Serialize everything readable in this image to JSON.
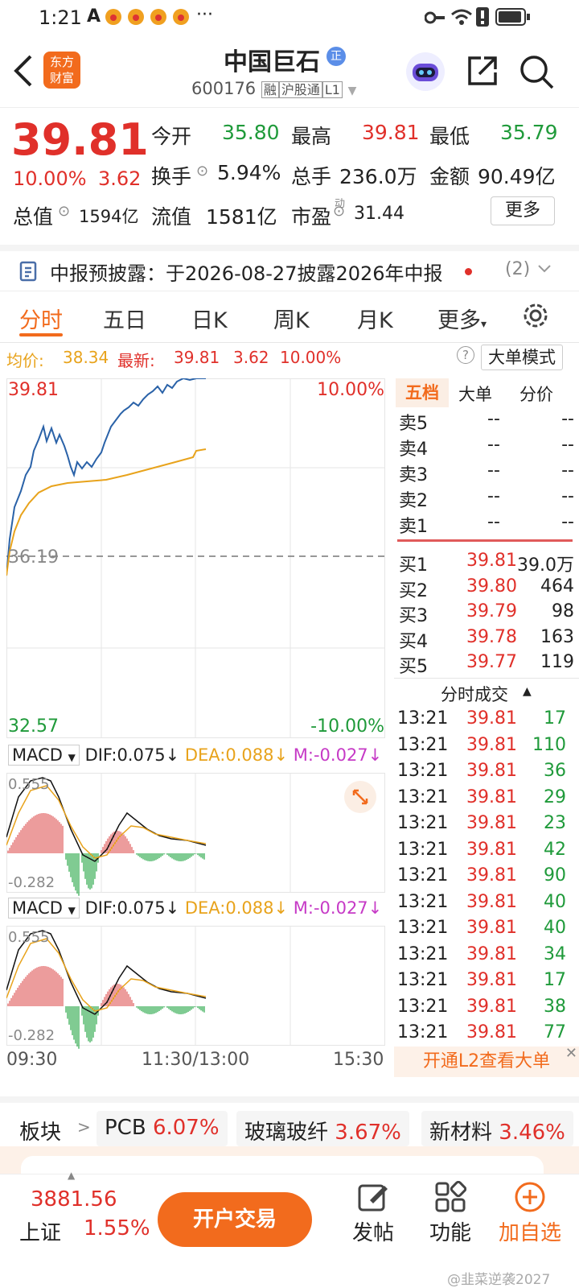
{
  "status_bar": {
    "time": "1:21",
    "alarm": "A",
    "dots": "···"
  },
  "header": {
    "logo_line1": "东方",
    "logo_line2": "财富",
    "title": "中国巨石",
    "title_badge": "正",
    "code": "600176",
    "tags": [
      "融",
      "沪股通",
      "L1"
    ]
  },
  "quote": {
    "price": "39.81",
    "change_pct": "10.00%",
    "change": "3.62",
    "open_label": "今开",
    "open": "35.80",
    "high_label": "最高",
    "high": "39.81",
    "low_label": "最低",
    "low": "35.79",
    "turnover_label": "换手",
    "turnover": "5.94%",
    "volume_label": "总手",
    "volume": "236.0万",
    "amount_label": "金额",
    "amount": "90.49亿",
    "mcap_label": "总值",
    "mcap": "1594亿",
    "float_label": "流值",
    "float": "1581亿",
    "pe_label": "市盈",
    "pe_sup": "动",
    "pe": "31.44",
    "more": "更多"
  },
  "notice": {
    "text": "中报预披露：于2026-08-27披露2026年中报",
    "count": "(2)"
  },
  "tabs": [
    "分时",
    "五日",
    "日K",
    "周K",
    "月K",
    "更多"
  ],
  "avg_bar": {
    "avg_label": "均价:",
    "avg": "38.34",
    "latest_label": "最新:",
    "latest": "39.81",
    "chg": "3.62",
    "pct": "10.00%",
    "mode": "大单模式"
  },
  "chart": {
    "top_price": "39.81",
    "top_pct": "10.00%",
    "mid_price": "36.19",
    "bottom_price": "32.57",
    "bottom_pct": "-10.00%",
    "x_labels": [
      "09:30",
      "11:30/13:00",
      "15:30"
    ],
    "macd": {
      "name": "MACD",
      "dif": "DIF:0.075↓",
      "dea": "DEA:0.088↓",
      "m": "M:-0.027↓",
      "top": "0.555",
      "bottom": "-0.282"
    }
  },
  "orderbook": {
    "tabs": [
      "五档",
      "大单",
      "分价"
    ],
    "asks": [
      {
        "l": "卖5",
        "p": "--",
        "v": "--"
      },
      {
        "l": "卖4",
        "p": "--",
        "v": "--"
      },
      {
        "l": "卖3",
        "p": "--",
        "v": "--"
      },
      {
        "l": "卖2",
        "p": "--",
        "v": "--"
      },
      {
        "l": "卖1",
        "p": "--",
        "v": "--"
      }
    ],
    "bids": [
      {
        "l": "买1",
        "p": "39.81",
        "v": "39.0万"
      },
      {
        "l": "买2",
        "p": "39.80",
        "v": "464"
      },
      {
        "l": "买3",
        "p": "39.79",
        "v": "98"
      },
      {
        "l": "买4",
        "p": "39.78",
        "v": "163"
      },
      {
        "l": "买5",
        "p": "39.77",
        "v": "119"
      }
    ]
  },
  "trades": {
    "title": "分时成交",
    "rows": [
      {
        "t": "13:21",
        "p": "39.81",
        "v": "17"
      },
      {
        "t": "13:21",
        "p": "39.81",
        "v": "110"
      },
      {
        "t": "13:21",
        "p": "39.81",
        "v": "36"
      },
      {
        "t": "13:21",
        "p": "39.81",
        "v": "29"
      },
      {
        "t": "13:21",
        "p": "39.81",
        "v": "23"
      },
      {
        "t": "13:21",
        "p": "39.81",
        "v": "42"
      },
      {
        "t": "13:21",
        "p": "39.81",
        "v": "90"
      },
      {
        "t": "13:21",
        "p": "39.81",
        "v": "40"
      },
      {
        "t": "13:21",
        "p": "39.81",
        "v": "40"
      },
      {
        "t": "13:21",
        "p": "39.81",
        "v": "34"
      },
      {
        "t": "13:21",
        "p": "39.81",
        "v": "17"
      },
      {
        "t": "13:21",
        "p": "39.81",
        "v": "38"
      },
      {
        "t": "13:21",
        "p": "39.81",
        "v": "77"
      }
    ],
    "l2": "开通L2查看大单"
  },
  "sector": {
    "label": "板块",
    "items": [
      {
        "name": "PCB",
        "pct": "6.07%"
      },
      {
        "name": "玻璃玻纤",
        "pct": "3.67%"
      },
      {
        "name": "新材料",
        "pct": "3.46%"
      }
    ]
  },
  "bottom": {
    "index_value": "3881.56",
    "index_name": "上证",
    "index_pct": "1.55%",
    "trade": "开户交易",
    "post": "发帖",
    "func": "功能",
    "add": "加自选",
    "watermark": "@韭菜逆袭2027"
  },
  "colors": {
    "up": "#e0302a",
    "down": "#1f9a3a",
    "brand": "#f26b1d",
    "price_line": "#2a62a8",
    "avg_line": "#e8a31c"
  }
}
